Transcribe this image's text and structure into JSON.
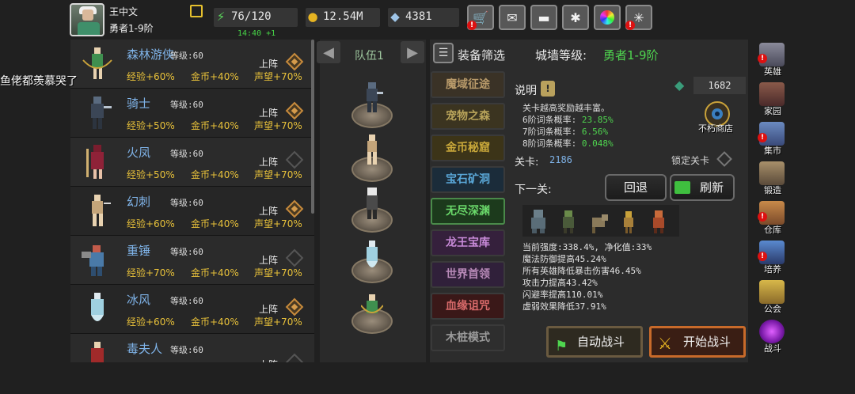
{
  "player": {
    "name": "王中文",
    "rank": "勇者1-9阶"
  },
  "resources": {
    "stamina": "76/120",
    "stamina_timer": "14:40 +1",
    "gold": "12.54M",
    "gems": "4381"
  },
  "toolbar": {
    "icons": [
      "shop-cart-icon",
      "mail-icon",
      "gamepad-icon",
      "gear-icon",
      "color-wheel-icon",
      "firework-icon"
    ]
  },
  "overlay_comment": "鱼佬都羡慕哭了",
  "hero_list": [
    {
      "name": "森林游侠",
      "level": "等级:60",
      "b1": "经验+60%",
      "b2": "金币+40%",
      "b3": "声望+70%",
      "deploy": "上阵",
      "deployed": true
    },
    {
      "name": "骑士",
      "level": "等级:60",
      "b1": "经验+50%",
      "b2": "金币+40%",
      "b3": "声望+70%",
      "deploy": "上阵",
      "deployed": true
    },
    {
      "name": "火凤",
      "level": "等级:60",
      "b1": "经验+50%",
      "b2": "金币+40%",
      "b3": "声望+70%",
      "deploy": "上阵",
      "deployed": false
    },
    {
      "name": "幻刺",
      "level": "等级:60",
      "b1": "经验+60%",
      "b2": "金币+40%",
      "b3": "声望+70%",
      "deploy": "上阵",
      "deployed": true
    },
    {
      "name": "重锤",
      "level": "等级:60",
      "b1": "经验+70%",
      "b2": "金币+40%",
      "b3": "声望+70%",
      "deploy": "上阵",
      "deployed": false
    },
    {
      "name": "冰风",
      "level": "等级:60",
      "b1": "经验+60%",
      "b2": "金币+40%",
      "b3": "声望+70%",
      "deploy": "上阵",
      "deployed": true
    },
    {
      "name": "毒夫人",
      "level": "等级:60",
      "b1": "",
      "b2": "",
      "b3": "",
      "deploy": "上阵",
      "deployed": false
    }
  ],
  "team": {
    "title": "队伍1"
  },
  "panel": {
    "filter_label": "装备筛选",
    "wall_label": "城墙等级:",
    "wall_value": "勇者1-9阶",
    "modes": [
      {
        "label": "魔域征途",
        "color": "#b89a6a",
        "bg": "#3a3226"
      },
      {
        "label": "宠物之森",
        "color": "#b8a35a",
        "bg": "#3b3420"
      },
      {
        "label": "金币秘窟",
        "color": "#c9a83a",
        "bg": "#3c3418"
      },
      {
        "label": "宝石矿洞",
        "color": "#5aa8d8",
        "bg": "#1b2c3a"
      },
      {
        "label": "无尽深渊",
        "color": "#6ad86a",
        "bg": "#1c3a1c"
      },
      {
        "label": "龙王宝库",
        "color": "#c88ad8",
        "bg": "#35203c"
      },
      {
        "label": "世界首领",
        "color": "#b88ab8",
        "bg": "#30203a"
      },
      {
        "label": "血缘诅咒",
        "color": "#d86a6a",
        "bg": "#3a1818"
      },
      {
        "label": "木桩模式",
        "color": "#9a9a9a",
        "bg": "#2e2e2e"
      }
    ],
    "desc_label": "说明",
    "gem_count": "1682",
    "info": {
      "line1": "关卡越高奖励越丰富。",
      "line2_label": "6阶词条概率:",
      "line2_val": "23.85%",
      "line3_label": "7阶词条概率:",
      "line3_val": "6.56%",
      "line4_label": "8阶词条概率:",
      "line4_val": "0.048%"
    },
    "shop_label": "不朽商店",
    "stage_label": "关卡:",
    "stage_value": "2186",
    "lock_label": "锁定关卡",
    "next_label": "下一关:",
    "back_button": "回退",
    "refresh_button": "刷新",
    "stats": [
      "当前强度:338.4%, 净化值:33%",
      "魔法防御提高45.24%",
      "所有英雄降低暴击伤害46.45%",
      "攻击力提高43.42%",
      "闪避率提高110.01%",
      "虚弱效果降低37.91%"
    ],
    "auto_battle": "自动战斗",
    "start_battle": "开始战斗"
  },
  "nav": [
    {
      "label": "英雄",
      "icon": "helmet-icon",
      "alert": true
    },
    {
      "label": "家园",
      "icon": "castle-icon",
      "alert": false
    },
    {
      "label": "集市",
      "icon": "market-icon",
      "alert": true
    },
    {
      "label": "锻造",
      "icon": "hammer-icon",
      "alert": false
    },
    {
      "label": "仓库",
      "icon": "chest-icon",
      "alert": true
    },
    {
      "label": "培养",
      "icon": "trophy-icon",
      "alert": true
    },
    {
      "label": "公会",
      "icon": "guild-icon",
      "alert": false
    },
    {
      "label": "战斗",
      "icon": "portal-icon",
      "alert": false
    }
  ],
  "colors": {
    "accent_green": "#4fd54f",
    "name_blue": "#7fb3e8",
    "bonus_gold": "#e9c23a"
  }
}
